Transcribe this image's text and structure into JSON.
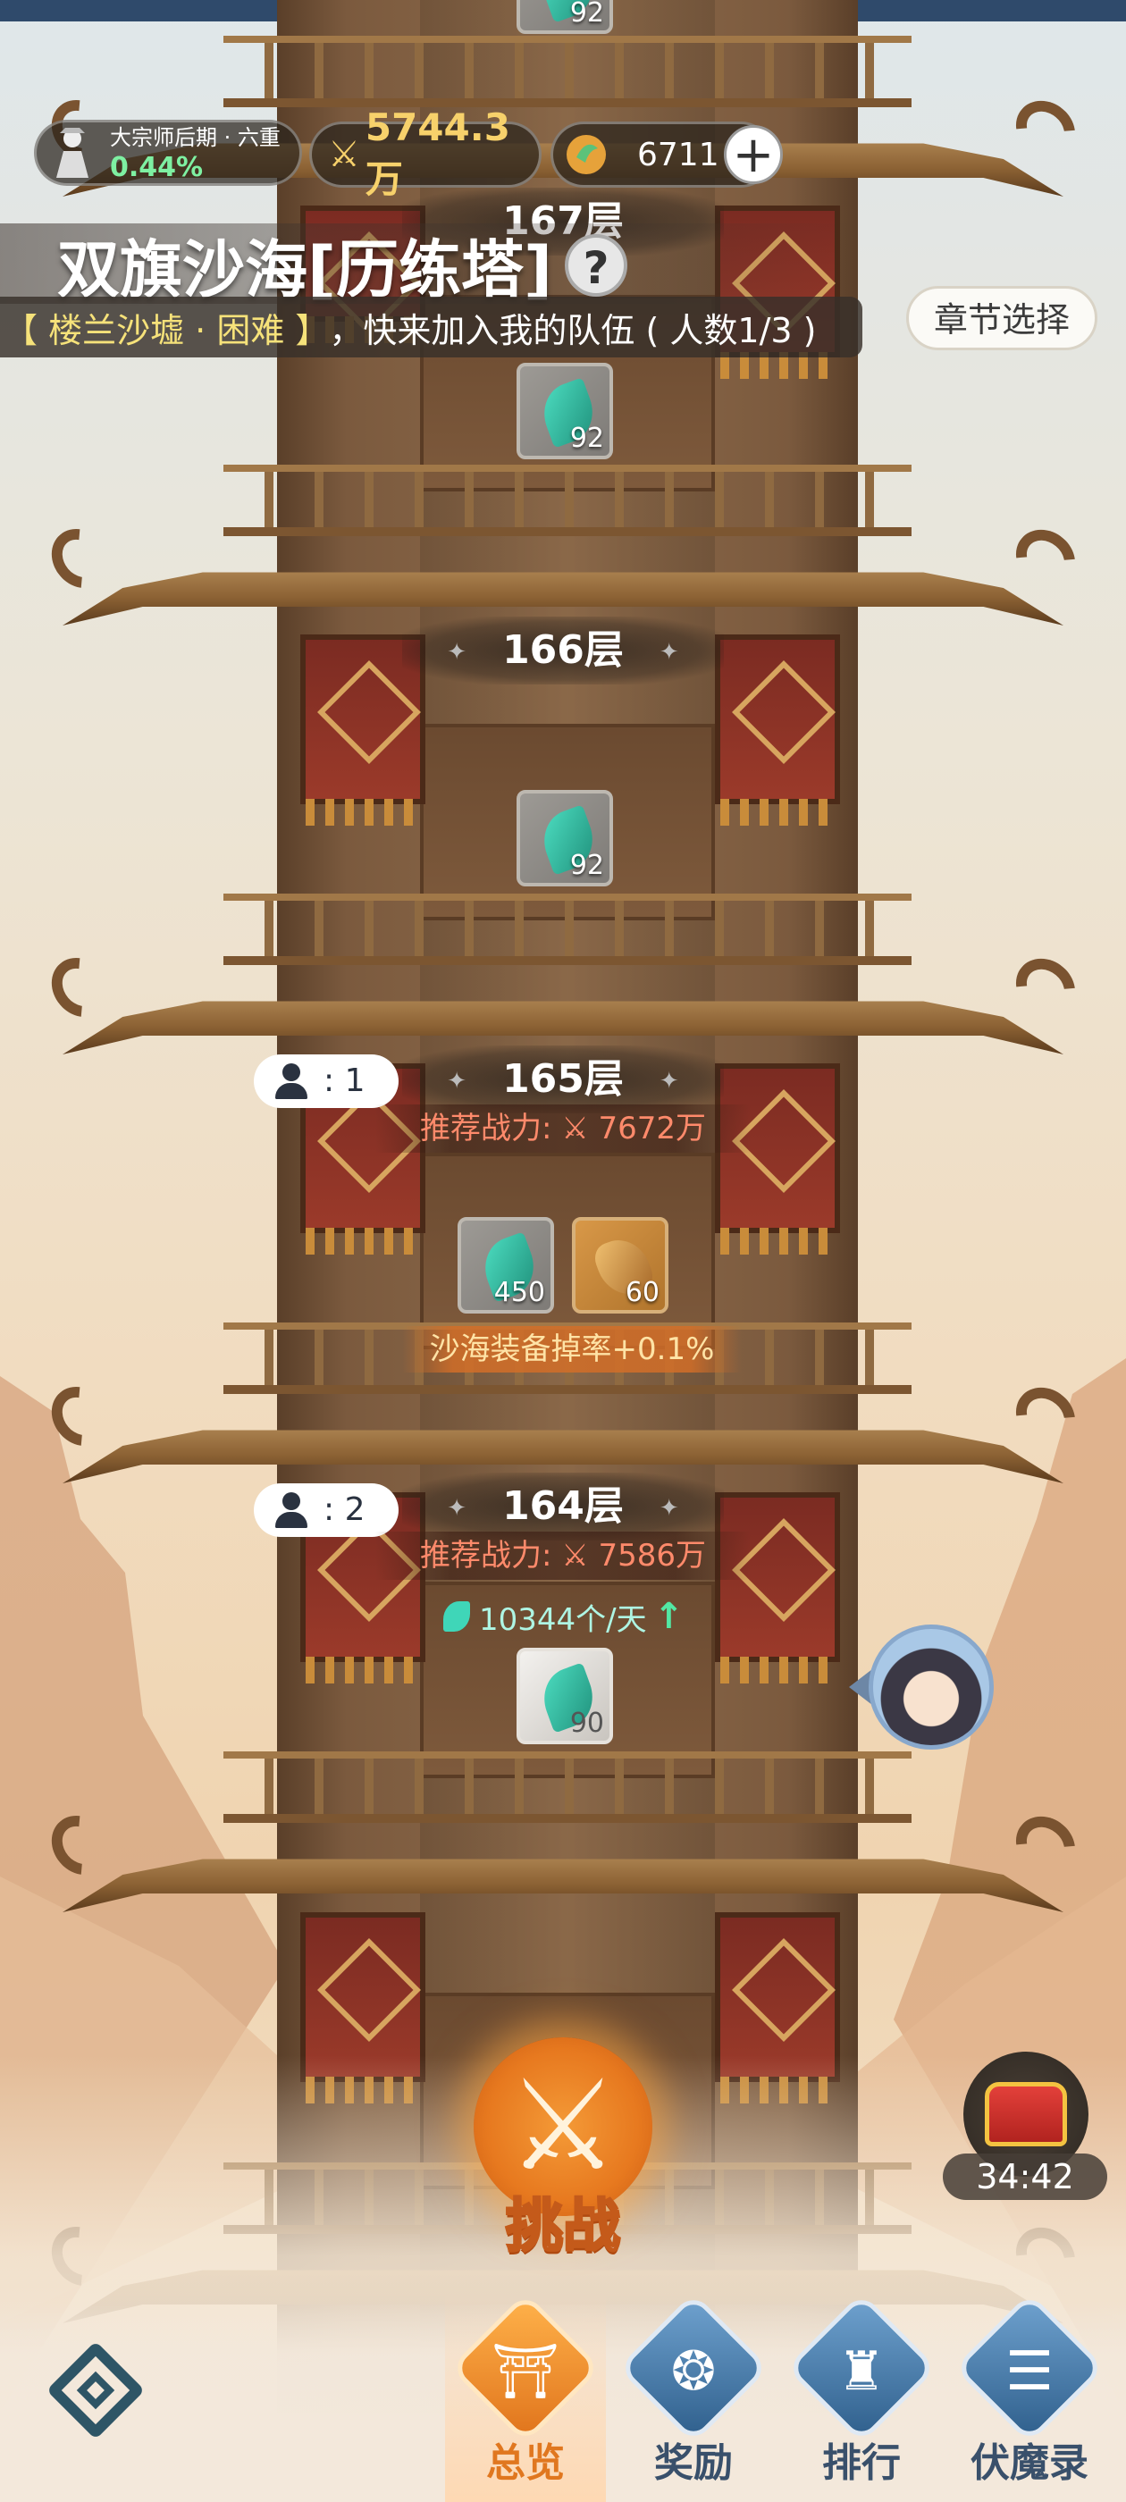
{
  "player": {
    "rank_title": "大宗师后期 · 六重",
    "rank_progress": "0.44%",
    "combat_power": "5744.3万",
    "coins": "6711"
  },
  "header": {
    "title": "双旗沙海[历练塔]",
    "help_label": "?",
    "invite_text_hl": "【 楼兰沙墟 · 困难 】",
    "invite_text": "，快来加入我的队伍 ( 人数1/3 )",
    "chapter_select_label": "章节选择"
  },
  "floors": [
    {
      "label": "167层",
      "reward_count": "92"
    },
    {
      "label": "166层",
      "reward_count": "92"
    },
    {
      "label": "165层",
      "team_count": "1",
      "recommended_power": "推荐战力: ⚔ 7672万",
      "rewards": [
        "450",
        "60"
      ],
      "bonus": "沙海装备掉率+0.1%"
    },
    {
      "label": "164层",
      "team_count": "2",
      "recommended_power": "推荐战力: ⚔ 7586万",
      "income": "10344个/天",
      "reward_count": "90"
    }
  ],
  "top_reward_count": "92",
  "team_prefix": ":",
  "challenge_label": "挑战",
  "chest_timer": "34:42",
  "nav": {
    "items": [
      {
        "label": "总览",
        "icon": "pagoda-icon",
        "active": true
      },
      {
        "label": "奖励",
        "icon": "reward-icon",
        "active": false
      },
      {
        "label": "排行",
        "icon": "ranking-icon",
        "active": false
      },
      {
        "label": "伏魔录",
        "icon": "scroll-icon",
        "active": false
      }
    ]
  },
  "colors": {
    "accent_orange": "#e0771f",
    "power_gold": "#f7d16b",
    "progress_green": "#7ef0a2",
    "recommended_red": "#ff8a6b",
    "nav_blue": "#39506b"
  }
}
